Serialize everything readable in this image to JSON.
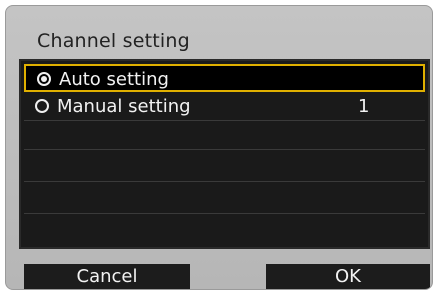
{
  "dialog": {
    "title": "Channel setting",
    "options": [
      {
        "label": "Auto setting",
        "value": "",
        "selected": true
      },
      {
        "label": "Manual setting",
        "value": "1",
        "selected": false
      }
    ],
    "cancel_label": "Cancel",
    "ok_label": "OK"
  },
  "colors": {
    "screen_bg": "#bdbdbd",
    "list_bg": "#1a1a1a",
    "highlight": "#e0b000",
    "text_light": "#f2f2f2"
  },
  "icons": {
    "selected_radio": "radio-selected-icon",
    "unselected_radio": "radio-unselected-icon"
  }
}
